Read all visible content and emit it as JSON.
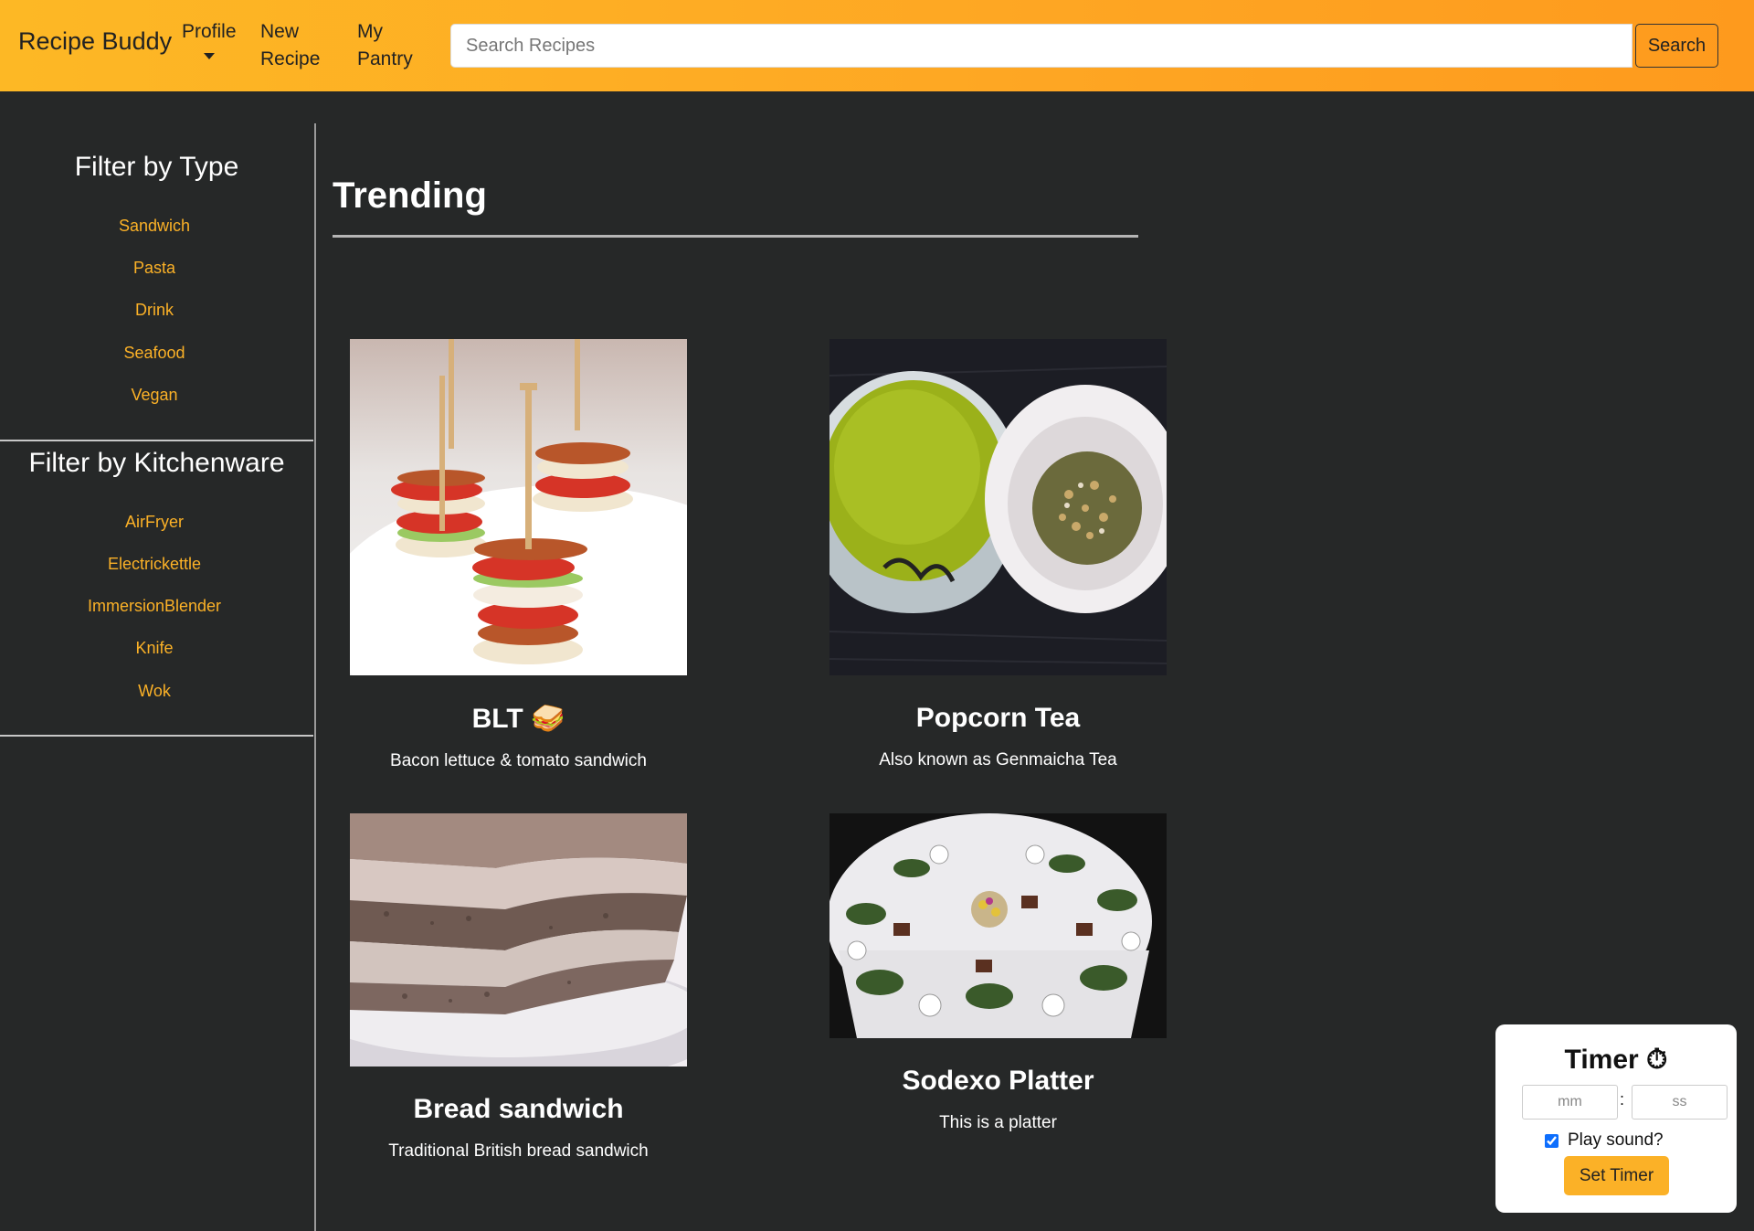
{
  "nav": {
    "brand": "Recipe Buddy",
    "profile": "Profile",
    "new_recipe": "New Recipe",
    "my_pantry": "My Pantry",
    "search_placeholder": "Search Recipes",
    "search_button": "Search"
  },
  "sidebar": {
    "type_heading": "Filter by Type",
    "types": [
      "Sandwich",
      "Pasta",
      "Drink",
      "Seafood",
      "Vegan"
    ],
    "kitchenware_heading": "Filter by Kitchenware",
    "kitchenware": [
      "AirFryer",
      "Electrickettle",
      "ImmersionBlender",
      "Knife",
      "Wok"
    ]
  },
  "main": {
    "title": "Trending",
    "recipes": [
      {
        "title": "BLT 🥪",
        "description": "Bacon lettuce & tomato sandwich"
      },
      {
        "title": "Popcorn Tea",
        "description": "Also known as Genmaicha Tea"
      },
      {
        "title": "Bread sandwich",
        "description": "Traditional British bread sandwich"
      },
      {
        "title": "Sodexo Platter",
        "description": "This is a platter"
      }
    ]
  },
  "timer": {
    "title": "Timer ⏱",
    "minutes_placeholder": "mm",
    "colon": ":",
    "seconds_placeholder": "ss",
    "play_sound_label": "Play sound?",
    "play_sound_checked": true,
    "set_button": "Set Timer"
  },
  "colors": {
    "accent": "#fbb127",
    "background": "#262828",
    "navbar_start": "#fdb825",
    "navbar_end": "#fe9a1d"
  }
}
